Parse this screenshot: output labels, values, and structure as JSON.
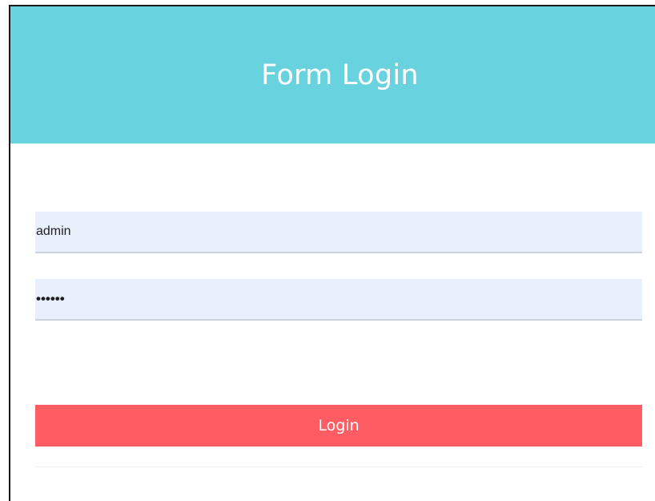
{
  "header": {
    "title": "Form Login"
  },
  "form": {
    "username_value": "admin",
    "password_value": "••••••",
    "login_label": "Login"
  },
  "colors": {
    "header_bg": "#69d2df",
    "field_bg": "#e8f0fe",
    "button_bg": "#ff5c64"
  }
}
